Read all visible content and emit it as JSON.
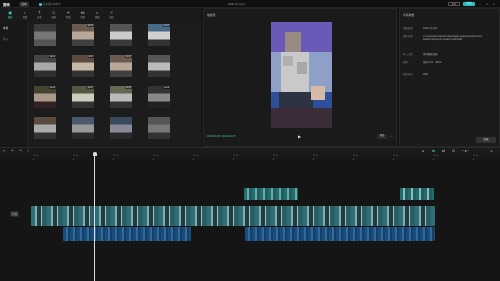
{
  "titlebar": {
    "logo": "剪映",
    "menu_label": "菜单",
    "autosave": "自动保存本地中",
    "doc_title": "0430 (1).mp4",
    "pro_label": "Pro",
    "export_label": "导出"
  },
  "tool_tabs": [
    {
      "label": "媒体",
      "icon": "media-icon",
      "glyph": "▣"
    },
    {
      "label": "音频",
      "icon": "audio-icon",
      "glyph": "♪"
    },
    {
      "label": "文本",
      "icon": "text-icon",
      "glyph": "T"
    },
    {
      "label": "贴纸",
      "icon": "sticker-icon",
      "glyph": "☺"
    },
    {
      "label": "特效",
      "icon": "effects-icon",
      "glyph": "✦"
    },
    {
      "label": "转场",
      "icon": "transition-icon",
      "glyph": "⋈"
    },
    {
      "label": "滤镜",
      "icon": "filter-icon",
      "glyph": "◐"
    },
    {
      "label": "调节",
      "icon": "adjust-icon",
      "glyph": "≡"
    }
  ],
  "media_sidebar": {
    "items": [
      "本地",
      "导入"
    ]
  },
  "media_items": [
    {
      "dur": ""
    },
    {
      "dur": "00:21"
    },
    {
      "dur": ""
    },
    {
      "dur": "00:05"
    },
    {
      "dur": "00:10"
    },
    {
      "dur": "00:11"
    },
    {
      "dur": "00:21"
    },
    {
      "dur": ""
    },
    {
      "dur": "00:04"
    },
    {
      "dur": "00:07"
    },
    {
      "dur": "00:12"
    },
    {
      "dur": "00:08"
    },
    {
      "dur": ""
    },
    {
      "dur": ""
    },
    {
      "dur": ""
    },
    {
      "dur": ""
    }
  ],
  "player": {
    "title": "播放器",
    "time": "00:00:04:15 / 00:00:21:07",
    "ratio_label": "原始",
    "play_icon": "▶",
    "fullscreen_icon": "⛶"
  },
  "details": {
    "title": "草稿参数",
    "rows": [
      {
        "k": "草稿名称:",
        "v": "0430 (1).mp4"
      },
      {
        "k": "保存位置:",
        "v": "C:/Users/Administrator/AppData/Local/JianyingPro/User Data/Projects/com.lveditor.draft/0430"
      },
      {
        "k": "导入工程:",
        "v": "素材跟随草稿"
      },
      {
        "k": "帧率:",
        "v": "竖屏 9:16 · 30fps"
      },
      {
        "k": "色彩空间:",
        "v": "SDR"
      }
    ],
    "modify_label": "修改"
  },
  "timeline": {
    "ticks": [
      "00:00",
      "00:05",
      "00:10",
      "00:15",
      "00:20",
      "00:25",
      "00:30",
      "00:35",
      "00:40",
      "00:45",
      "00:50",
      "00:55",
      "01:00"
    ],
    "track_label": "封面"
  },
  "colors": {
    "accent": "#3fd4d2",
    "export": "#23c0bf",
    "clip_teal": "#1f6f6f",
    "clip_blue": "#1b4d7a"
  }
}
